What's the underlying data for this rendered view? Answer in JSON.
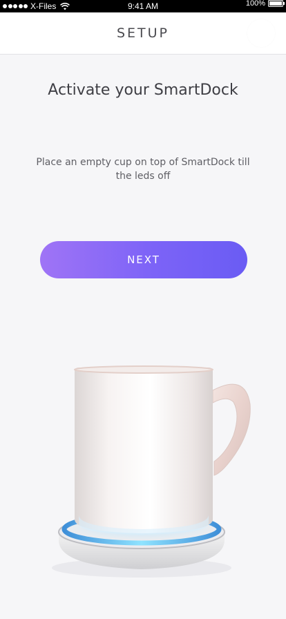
{
  "status_bar": {
    "carrier": "X-Files",
    "time": "9:41 AM",
    "battery_percent": "100%",
    "battery_level": 1.0
  },
  "header": {
    "title": "SETUP"
  },
  "main": {
    "headline": "Activate your SmartDock",
    "instructions": "Place an empty cup on top of SmartDock till the leds off",
    "next_label": "NEXT"
  },
  "icons": {
    "signal": "signal-dots-icon",
    "wifi": "wifi-icon",
    "battery": "battery-icon"
  },
  "colors": {
    "button_gradient_start": "#9f74f6",
    "button_gradient_end": "#6a5cf4",
    "led_glow": "#4fc3f7",
    "background": "#f6f6f8"
  }
}
